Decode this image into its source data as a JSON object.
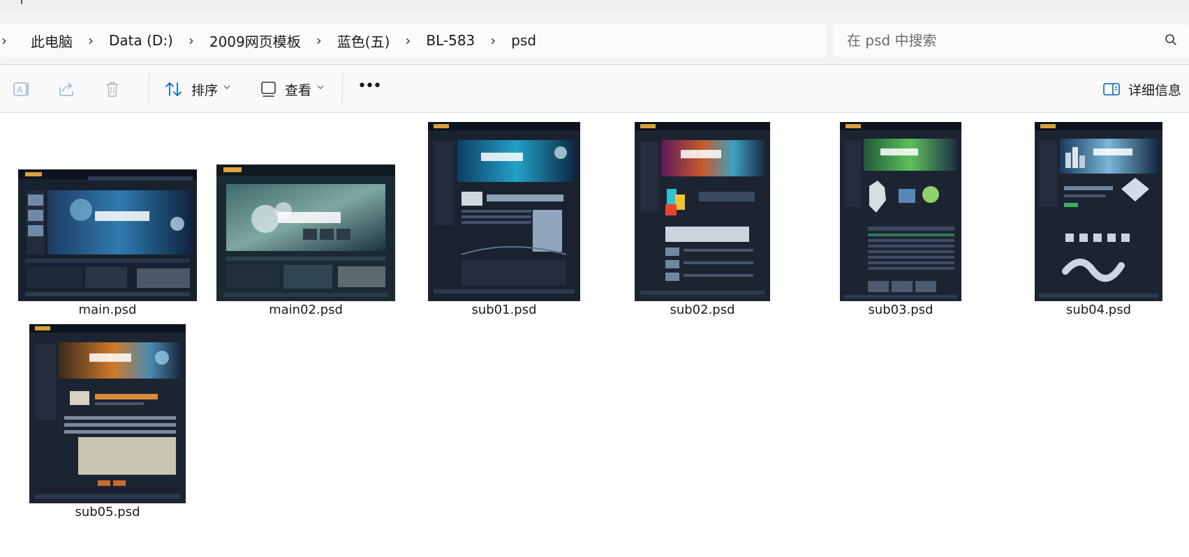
{
  "address_bar": {
    "path": [
      "此电脑",
      "Data (D:)",
      "2009网页模板",
      "蓝色(五)",
      "BL-583",
      "psd"
    ],
    "separator": "›"
  },
  "search": {
    "placeholder": "在 psd 中搜索"
  },
  "toolbar": {
    "sort_label": "排序",
    "view_label": "查看",
    "more_label": "•••",
    "details_label": "详细信息"
  },
  "files": [
    {
      "name": "main.psd",
      "theme": "creative-blue"
    },
    {
      "name": "main02.psd",
      "theme": "creative-green"
    },
    {
      "name": "sub01.psd",
      "theme": "digital-business"
    },
    {
      "name": "sub02.psd",
      "theme": "digital-product"
    },
    {
      "name": "sub03.psd",
      "theme": "digital-map"
    },
    {
      "name": "sub04.psd",
      "theme": "digital-city"
    },
    {
      "name": "sub05.psd",
      "theme": "digital-qa"
    }
  ],
  "colors": {
    "accent": "#0067c0",
    "thumb_dark": "#1b2330",
    "text": "#1b1b1b"
  }
}
